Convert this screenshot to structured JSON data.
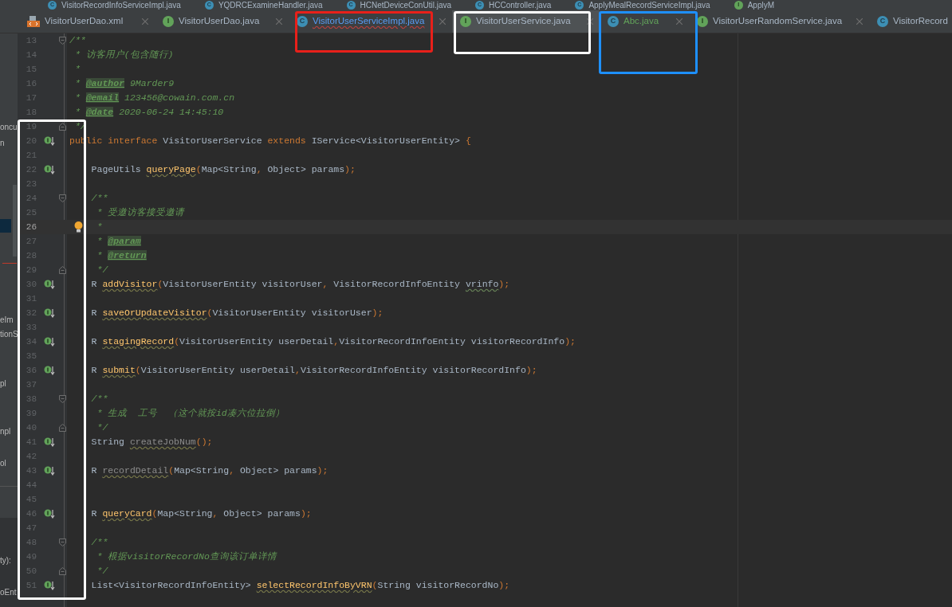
{
  "top_tabs": [
    {
      "label": "VisitorRecordInfoServiceImpl.java",
      "kind": "class",
      "badge": "C"
    },
    {
      "label": "YQDRCExamineHandler.java",
      "kind": "class",
      "badge": "C"
    },
    {
      "label": "HCNetDeviceConUtil.java",
      "kind": "class",
      "badge": "C"
    },
    {
      "label": "HCController.java",
      "kind": "class",
      "badge": "C"
    },
    {
      "label": "ApplyMealRecordServiceImpl.java",
      "kind": "class",
      "badge": "C"
    },
    {
      "label": "ApplyM",
      "kind": "interface",
      "badge": "I"
    }
  ],
  "tabs": [
    {
      "label": "VisitorUserDao.xml",
      "kind": "xml",
      "selected": false,
      "has_error": false,
      "added": false
    },
    {
      "label": "VisitorUserDao.java",
      "kind": "interface",
      "badge": "I",
      "selected": false,
      "has_error": false,
      "added": false
    },
    {
      "label": "VisitorUserServiceImpl.java",
      "kind": "class",
      "badge": "C",
      "selected": false,
      "has_error": true,
      "added": false
    },
    {
      "label": "VisitorUserService.java",
      "kind": "interface",
      "badge": "I",
      "selected": true,
      "has_error": false,
      "added": false
    },
    {
      "label": "Abc.java",
      "kind": "class",
      "badge": "C",
      "selected": false,
      "has_error": false,
      "added": true
    },
    {
      "label": "VisitorUserRandomService.java",
      "kind": "interface",
      "badge": "I",
      "selected": false,
      "has_error": false,
      "added": false
    },
    {
      "label": "VisitorRecord",
      "kind": "class",
      "badge": "C",
      "selected": false,
      "has_error": false,
      "added": false
    }
  ],
  "sidebar_fragments": [
    "oncu",
    "n",
    "eIm",
    "tionS",
    "pl",
    "npl",
    "ol",
    "ty):",
    "oEnt"
  ],
  "lines": [
    {
      "number": "13",
      "current": false,
      "fold_start": true,
      "tokens": [
        {
          "kind": "doc",
          "text": "/**"
        }
      ]
    },
    {
      "number": "14",
      "current": false,
      "tokens": [
        {
          "kind": "doc",
          "text": " * 访客用户(包含随行)"
        }
      ]
    },
    {
      "number": "15",
      "current": false,
      "tokens": [
        {
          "kind": "doc",
          "text": " *"
        }
      ]
    },
    {
      "number": "16",
      "current": false,
      "tokens": [
        {
          "kind": "doc",
          "text": " * "
        },
        {
          "kind": "doctag",
          "text": "@author"
        },
        {
          "kind": "doc",
          "text": " 9Marder9"
        }
      ]
    },
    {
      "number": "17",
      "current": false,
      "tokens": [
        {
          "kind": "doc",
          "text": " * "
        },
        {
          "kind": "doctag",
          "text": "@email"
        },
        {
          "kind": "doc",
          "text": " 123456@cowain.com.cn"
        }
      ]
    },
    {
      "number": "18",
      "current": false,
      "tokens": [
        {
          "kind": "doc",
          "text": " * "
        },
        {
          "kind": "doctag",
          "text": "@date"
        },
        {
          "kind": "doc",
          "text": " 2020-06-24 14:45:10"
        }
      ]
    },
    {
      "number": "19",
      "current": false,
      "fold_end": true,
      "tokens": [
        {
          "kind": "doc",
          "text": " */"
        }
      ]
    },
    {
      "number": "20",
      "current": false,
      "implemented": true,
      "tokens": [
        {
          "kind": "kw",
          "text": "public interface "
        },
        {
          "kind": "plain",
          "text": "VisitorUserService "
        },
        {
          "kind": "kw",
          "text": "extends "
        },
        {
          "kind": "plain",
          "text": "IService<VisitorUserEntity> "
        },
        {
          "kind": "punc",
          "text": "{"
        }
      ]
    },
    {
      "number": "21",
      "current": false
    },
    {
      "number": "22",
      "current": false,
      "indented": true,
      "implemented": true,
      "tokens": [
        {
          "kind": "plain",
          "text": "PageUtils "
        },
        {
          "kind": "fn",
          "text": "queryPage"
        },
        {
          "kind": "punc",
          "text": "("
        },
        {
          "kind": "plain",
          "text": "Map<String"
        },
        {
          "kind": "punc",
          "text": ", "
        },
        {
          "kind": "plain",
          "text": "Object> params"
        },
        {
          "kind": "punc",
          "text": ");"
        }
      ]
    },
    {
      "number": "23",
      "current": false
    },
    {
      "number": "24",
      "current": false,
      "indented": true,
      "fold_start": true,
      "tokens": [
        {
          "kind": "doc",
          "text": "/**"
        }
      ]
    },
    {
      "number": "25",
      "current": false,
      "indented": true,
      "tokens": [
        {
          "kind": "doc",
          "text": " * 受邀访客接受邀请"
        }
      ]
    },
    {
      "number": "26",
      "current": true,
      "indented": true,
      "bulb": true,
      "tokens": [
        {
          "kind": "doc",
          "text": " *"
        }
      ]
    },
    {
      "number": "27",
      "current": false,
      "indented": true,
      "tokens": [
        {
          "kind": "doc",
          "text": " * "
        },
        {
          "kind": "doctag",
          "text": "@param"
        }
      ]
    },
    {
      "number": "28",
      "current": false,
      "indented": true,
      "tokens": [
        {
          "kind": "doc",
          "text": " * "
        },
        {
          "kind": "doctag",
          "text": "@return"
        }
      ]
    },
    {
      "number": "29",
      "current": false,
      "indented": true,
      "fold_end": true,
      "tokens": [
        {
          "kind": "doc",
          "text": " */"
        }
      ]
    },
    {
      "number": "30",
      "current": false,
      "indented": true,
      "implemented": true,
      "tokens": [
        {
          "kind": "plain",
          "text": "R "
        },
        {
          "kind": "fn",
          "text": "addVisitor"
        },
        {
          "kind": "punc",
          "text": "("
        },
        {
          "kind": "plain",
          "text": "VisitorUserEntity visitorUser"
        },
        {
          "kind": "punc",
          "text": ", "
        },
        {
          "kind": "plain",
          "text": "VisitorRecordInfoEntity "
        },
        {
          "kind": "typo",
          "text": "vrinfo"
        },
        {
          "kind": "punc",
          "text": ");"
        }
      ]
    },
    {
      "number": "31",
      "current": false
    },
    {
      "number": "32",
      "current": false,
      "indented": true,
      "implemented": true,
      "tokens": [
        {
          "kind": "plain",
          "text": "R "
        },
        {
          "kind": "fn",
          "text": "saveOrUpdateVisitor"
        },
        {
          "kind": "punc",
          "text": "("
        },
        {
          "kind": "plain",
          "text": "VisitorUserEntity visitorUser"
        },
        {
          "kind": "punc",
          "text": ");"
        }
      ]
    },
    {
      "number": "33",
      "current": false
    },
    {
      "number": "34",
      "current": false,
      "indented": true,
      "implemented": true,
      "tokens": [
        {
          "kind": "plain",
          "text": "R "
        },
        {
          "kind": "fn",
          "text": "stagingRecord"
        },
        {
          "kind": "punc",
          "text": "("
        },
        {
          "kind": "plain",
          "text": "VisitorUserEntity userDetail"
        },
        {
          "kind": "punc",
          "text": ","
        },
        {
          "kind": "plain",
          "text": "VisitorRecordInfoEntity visitorRecordInfo"
        },
        {
          "kind": "punc",
          "text": ");"
        }
      ]
    },
    {
      "number": "35",
      "current": false
    },
    {
      "number": "36",
      "current": false,
      "indented": true,
      "implemented": true,
      "tokens": [
        {
          "kind": "plain",
          "text": "R "
        },
        {
          "kind": "fn",
          "text": "submit"
        },
        {
          "kind": "punc",
          "text": "("
        },
        {
          "kind": "plain",
          "text": "VisitorUserEntity userDetail"
        },
        {
          "kind": "punc",
          "text": ","
        },
        {
          "kind": "plain",
          "text": "VisitorRecordInfoEntity visitorRecordInfo"
        },
        {
          "kind": "punc",
          "text": ");"
        }
      ]
    },
    {
      "number": "37",
      "current": false
    },
    {
      "number": "38",
      "current": false,
      "indented": true,
      "fold_start": true,
      "tokens": [
        {
          "kind": "doc",
          "text": "/**"
        }
      ]
    },
    {
      "number": "39",
      "current": false,
      "indented": true,
      "tokens": [
        {
          "kind": "doc",
          "text": " * 生成  工号  （这个就按id凑六位拉倒）"
        }
      ]
    },
    {
      "number": "40",
      "current": false,
      "indented": true,
      "fold_end": true,
      "tokens": [
        {
          "kind": "doc",
          "text": " */"
        }
      ]
    },
    {
      "number": "41",
      "current": false,
      "indented": true,
      "implemented": true,
      "tokens": [
        {
          "kind": "plain",
          "text": "String "
        },
        {
          "kind": "unused",
          "text": "createJobNum"
        },
        {
          "kind": "punc",
          "text": "();"
        }
      ]
    },
    {
      "number": "42",
      "current": false
    },
    {
      "number": "43",
      "current": false,
      "indented": true,
      "implemented": true,
      "tokens": [
        {
          "kind": "plain",
          "text": "R "
        },
        {
          "kind": "unused",
          "text": "recordDetail"
        },
        {
          "kind": "punc",
          "text": "("
        },
        {
          "kind": "plain",
          "text": "Map<String"
        },
        {
          "kind": "punc",
          "text": ", "
        },
        {
          "kind": "plain",
          "text": "Object> params"
        },
        {
          "kind": "punc",
          "text": ");"
        }
      ]
    },
    {
      "number": "44",
      "current": false
    },
    {
      "number": "45",
      "current": false
    },
    {
      "number": "46",
      "current": false,
      "indented": true,
      "implemented": true,
      "tokens": [
        {
          "kind": "plain",
          "text": "R "
        },
        {
          "kind": "fn",
          "text": "queryCard"
        },
        {
          "kind": "punc",
          "text": "("
        },
        {
          "kind": "plain",
          "text": "Map<String"
        },
        {
          "kind": "punc",
          "text": ", "
        },
        {
          "kind": "plain",
          "text": "Object> params"
        },
        {
          "kind": "punc",
          "text": ");"
        }
      ]
    },
    {
      "number": "47",
      "current": false
    },
    {
      "number": "48",
      "current": false,
      "indented": true,
      "fold_start": true,
      "tokens": [
        {
          "kind": "doc",
          "text": "/**"
        }
      ]
    },
    {
      "number": "49",
      "current": false,
      "indented": true,
      "tokens": [
        {
          "kind": "doc",
          "text": " * 根据visitorRecordNo查询该订单详情"
        }
      ]
    },
    {
      "number": "50",
      "current": false,
      "indented": true,
      "fold_end": true,
      "tokens": [
        {
          "kind": "doc",
          "text": " */"
        }
      ]
    },
    {
      "number": "51",
      "current": false,
      "indented": true,
      "implemented": true,
      "tokens": [
        {
          "kind": "plain",
          "text": "List<VisitorRecordInfoEntity> "
        },
        {
          "kind": "fn",
          "text": "selectRecordInfoByVRN"
        },
        {
          "kind": "punc",
          "text": "("
        },
        {
          "kind": "plain",
          "text": "String visitorRecordNo"
        },
        {
          "kind": "punc",
          "text": ");"
        }
      ]
    }
  ],
  "annotations": [
    {
      "color": "#e8201a"
    },
    {
      "color": "#ffffff"
    },
    {
      "color": "#1e90ff"
    },
    {
      "color": "#ffffff"
    }
  ]
}
